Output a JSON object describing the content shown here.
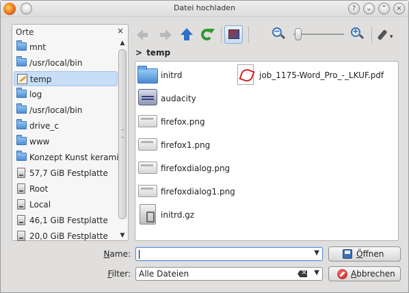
{
  "window": {
    "title": "Datei hochladen"
  },
  "places": {
    "header": "Orte",
    "close_glyph": "×",
    "items": [
      {
        "label": "mnt",
        "icon": "folder-icon"
      },
      {
        "label": "/usr/local/bin",
        "icon": "folder-icon"
      },
      {
        "label": "temp",
        "icon": "edit-folder-icon",
        "selected": true
      },
      {
        "label": "log",
        "icon": "folder-icon"
      },
      {
        "label": "/usr/local/bin",
        "icon": "folder-icon"
      },
      {
        "label": "drive_c",
        "icon": "folder-icon"
      },
      {
        "label": "www",
        "icon": "folder-icon"
      },
      {
        "label": "Konzept Kunst keramik",
        "icon": "folder-icon"
      },
      {
        "label": "57,7 GiB Festplatte",
        "icon": "drive-icon"
      },
      {
        "label": "Root",
        "icon": "drive-icon"
      },
      {
        "label": "Local",
        "icon": "drive-icon"
      },
      {
        "label": "46,1 GiB Festplatte",
        "icon": "drive-icon"
      },
      {
        "label": "20,0 GiB Festplatte",
        "icon": "drive-icon"
      }
    ]
  },
  "breadcrumb": {
    "separator": ">",
    "current": "temp"
  },
  "files": [
    {
      "name": "initrd",
      "icon": "folder-icon"
    },
    {
      "name": "job_1175-Word_Pro_-_LKUF.pdf",
      "icon": "pdf-icon"
    },
    {
      "name": "audacity",
      "icon": "application-icon"
    },
    {
      "name": "firefox.png",
      "icon": "image-icon"
    },
    {
      "name": "firefox1.png",
      "icon": "image-icon"
    },
    {
      "name": "firefoxdialog.png",
      "icon": "image-icon"
    },
    {
      "name": "firefoxdialog1.png",
      "icon": "image-icon"
    },
    {
      "name": "initrd.gz",
      "icon": "archive-icon"
    }
  ],
  "form": {
    "name_label_underlined": "N",
    "name_label_rest": "ame:",
    "name_value": "",
    "filter_label_underlined": "F",
    "filter_label_rest": "ilter:",
    "filter_value": "Alle Dateien",
    "open_button_underlined": "Ö",
    "open_button_rest": "ffnen",
    "cancel_button_underlined": "A",
    "cancel_button_rest": "bbrechen"
  },
  "colors": {
    "selection": "#c7def6",
    "folder": "#4d8fd6",
    "accent_up": "#2f6fc6",
    "reload": "#2b9a2e",
    "cancel": "#c01919"
  }
}
